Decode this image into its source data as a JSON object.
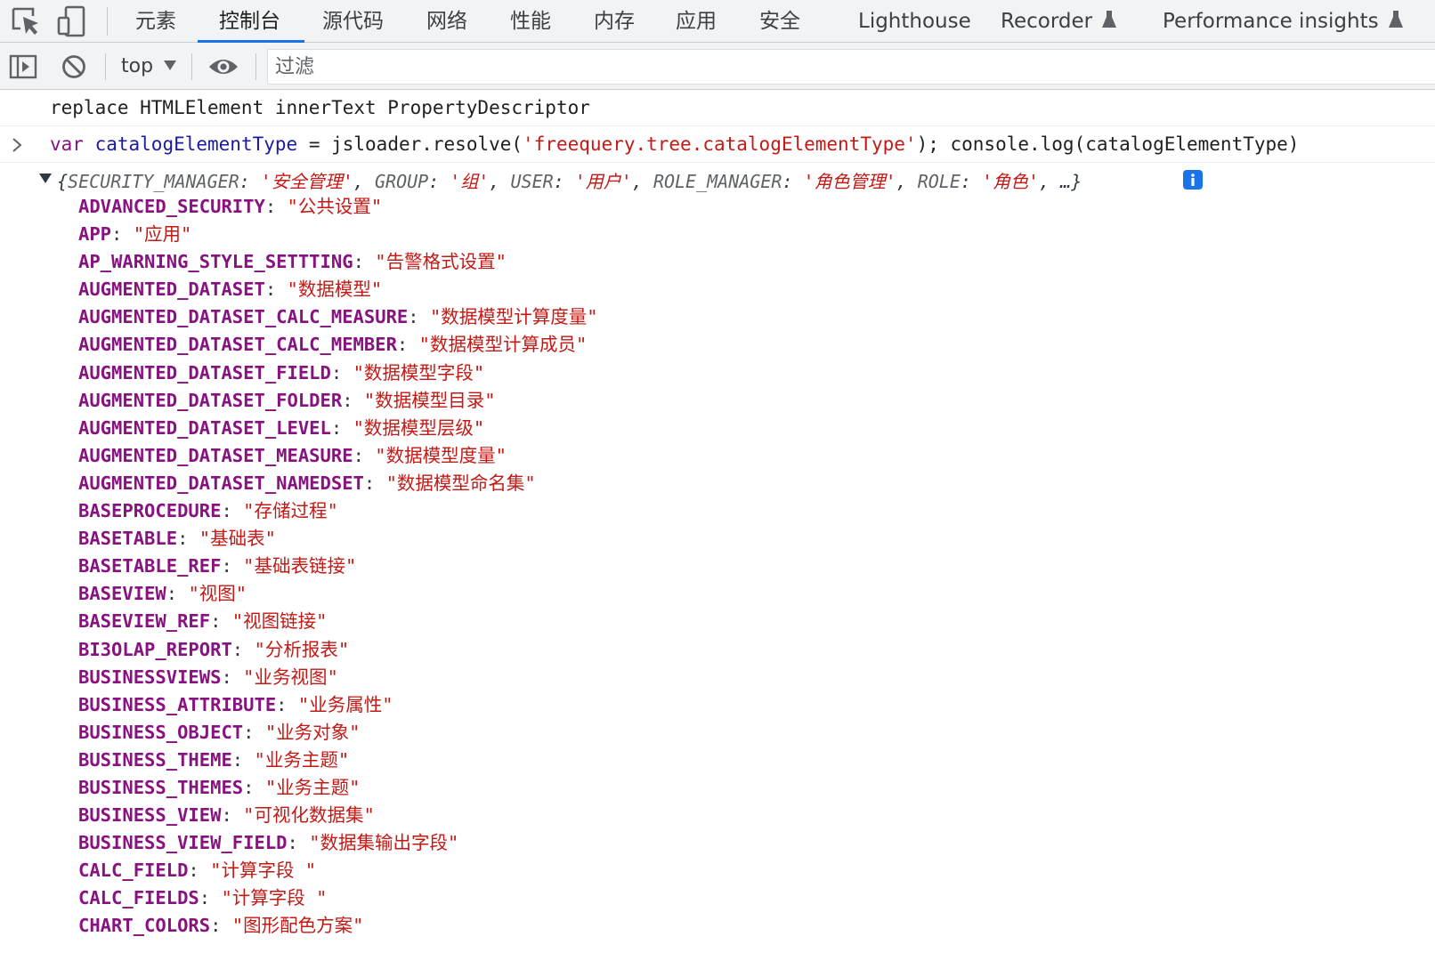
{
  "tabs": [
    {
      "label": "元素"
    },
    {
      "label": "控制台"
    },
    {
      "label": "源代码"
    },
    {
      "label": "网络"
    },
    {
      "label": "性能"
    },
    {
      "label": "内存"
    },
    {
      "label": "应用"
    },
    {
      "label": "安全"
    },
    {
      "label": "Lighthouse"
    },
    {
      "label": "Recorder"
    },
    {
      "label": "Performance insights"
    }
  ],
  "active_tab": "控制台",
  "accent_color": "#1a73e8",
  "toolbar": {
    "context": "top",
    "filter_placeholder": "过滤"
  },
  "console": {
    "log_line": "replace HTMLElement innerText PropertyDescriptor",
    "input": {
      "keyword": "var",
      "var_name": "catalogElementType",
      "part1": " = jsloader.resolve(",
      "string_arg": "'freequery.tree.catalogElementType'",
      "part2": "); console.log(catalogElementType)"
    },
    "object_preview": {
      "open": "{",
      "entries": [
        {
          "key": "SECURITY_MANAGER",
          "value": "'安全管理'"
        },
        {
          "key": "GROUP",
          "value": "'组'"
        },
        {
          "key": "USER",
          "value": "'用户'"
        },
        {
          "key": "ROLE_MANAGER",
          "value": "'角色管理'"
        },
        {
          "key": "ROLE",
          "value": "'角色'"
        }
      ],
      "ellipsis": "…}"
    },
    "properties": [
      {
        "key": "ADVANCED_SECURITY",
        "value": "\"公共设置\""
      },
      {
        "key": "APP",
        "value": "\"应用\""
      },
      {
        "key": "AP_WARNING_STYLE_SETTTING",
        "value": "\"告警格式设置\""
      },
      {
        "key": "AUGMENTED_DATASET",
        "value": "\"数据模型\""
      },
      {
        "key": "AUGMENTED_DATASET_CALC_MEASURE",
        "value": "\"数据模型计算度量\""
      },
      {
        "key": "AUGMENTED_DATASET_CALC_MEMBER",
        "value": "\"数据模型计算成员\""
      },
      {
        "key": "AUGMENTED_DATASET_FIELD",
        "value": "\"数据模型字段\""
      },
      {
        "key": "AUGMENTED_DATASET_FOLDER",
        "value": "\"数据模型目录\""
      },
      {
        "key": "AUGMENTED_DATASET_LEVEL",
        "value": "\"数据模型层级\""
      },
      {
        "key": "AUGMENTED_DATASET_MEASURE",
        "value": "\"数据模型度量\""
      },
      {
        "key": "AUGMENTED_DATASET_NAMEDSET",
        "value": "\"数据模型命名集\""
      },
      {
        "key": "BASEPROCEDURE",
        "value": "\"存储过程\""
      },
      {
        "key": "BASETABLE",
        "value": "\"基础表\""
      },
      {
        "key": "BASETABLE_REF",
        "value": "\"基础表链接\""
      },
      {
        "key": "BASEVIEW",
        "value": "\"视图\""
      },
      {
        "key": "BASEVIEW_REF",
        "value": "\"视图链接\""
      },
      {
        "key": "BI3OLAP_REPORT",
        "value": "\"分析报表\""
      },
      {
        "key": "BUSINESSVIEWS",
        "value": "\"业务视图\""
      },
      {
        "key": "BUSINESS_ATTRIBUTE",
        "value": "\"业务属性\""
      },
      {
        "key": "BUSINESS_OBJECT",
        "value": "\"业务对象\""
      },
      {
        "key": "BUSINESS_THEME",
        "value": "\"业务主题\""
      },
      {
        "key": "BUSINESS_THEMES",
        "value": "\"业务主题\""
      },
      {
        "key": "BUSINESS_VIEW",
        "value": "\"可视化数据集\""
      },
      {
        "key": "BUSINESS_VIEW_FIELD",
        "value": "\"数据集输出字段\""
      },
      {
        "key": "CALC_FIELD",
        "value": "\"计算字段 \""
      },
      {
        "key": "CALC_FIELDS",
        "value": "\"计算字段 \""
      },
      {
        "key": "CHART_COLORS",
        "value": "\"图形配色方案\""
      }
    ]
  }
}
